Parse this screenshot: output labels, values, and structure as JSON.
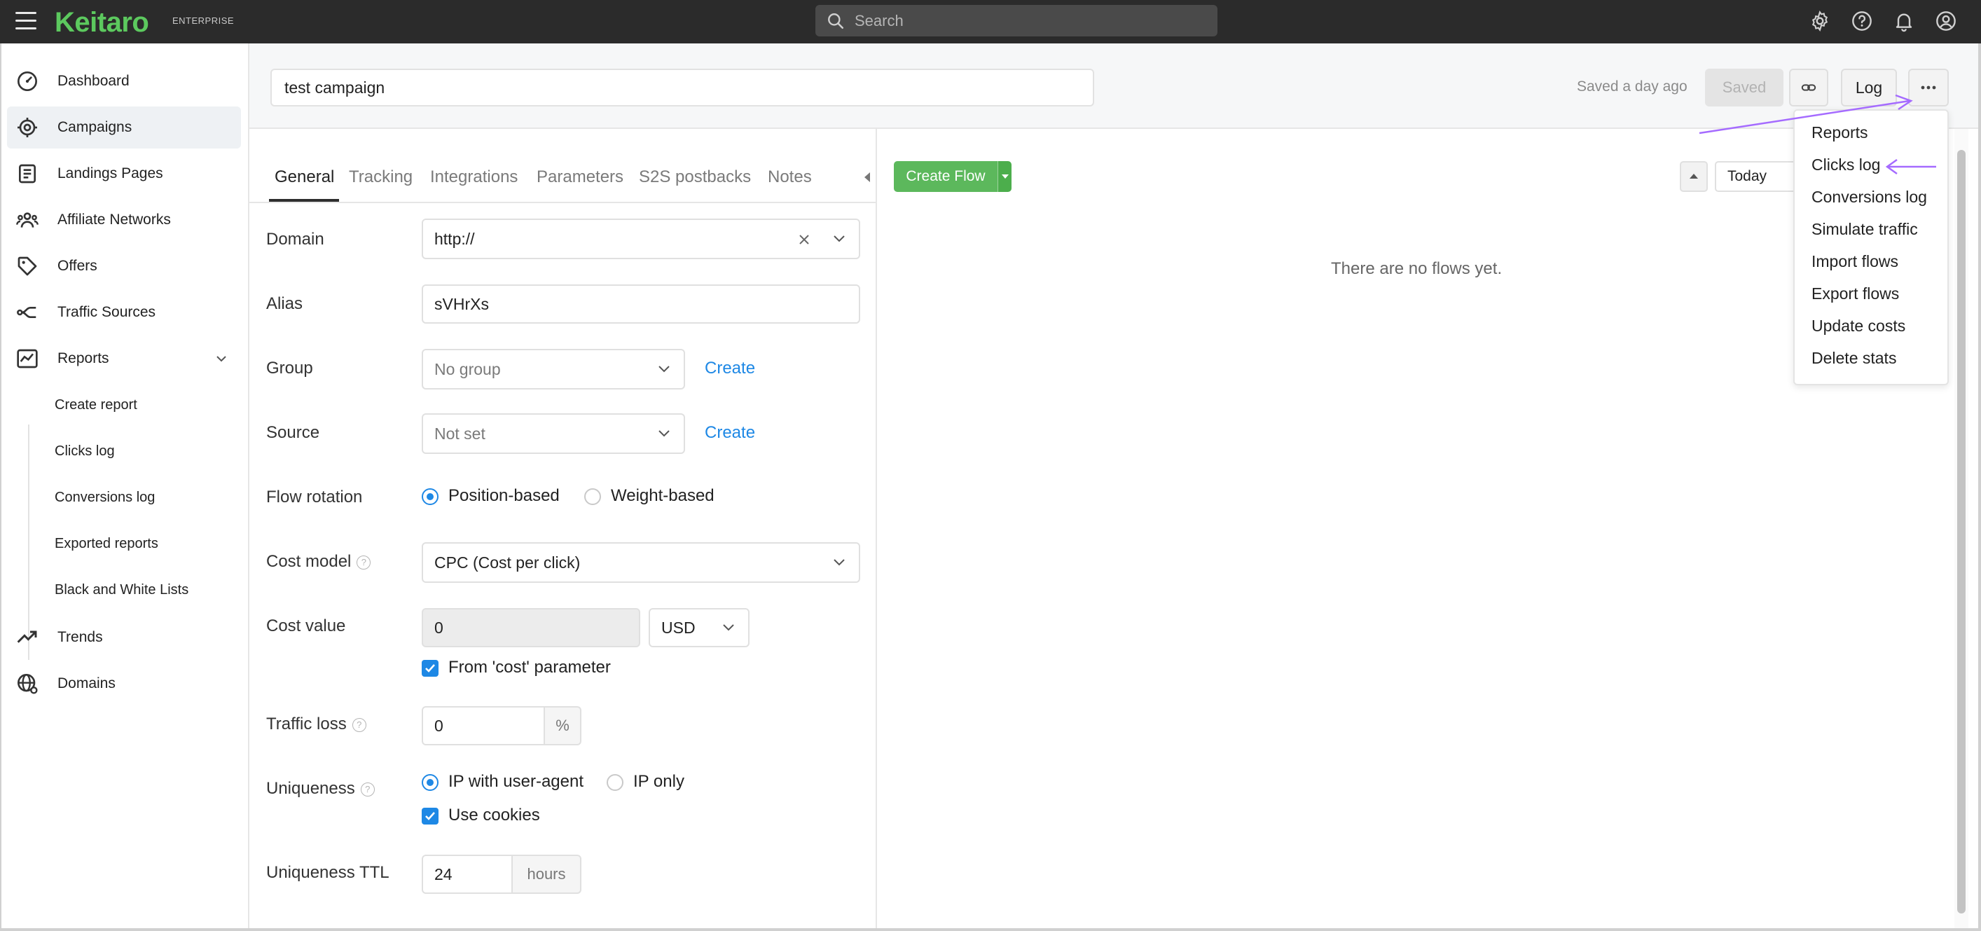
{
  "app": {
    "logo": "Keitaro",
    "edition": "ENTERPRISE",
    "search_placeholder": "Search"
  },
  "sidebar": {
    "items": [
      {
        "label": "Dashboard",
        "icon": "dashboard-icon"
      },
      {
        "label": "Campaigns",
        "icon": "target-icon",
        "active": true
      },
      {
        "label": "Landings Pages",
        "icon": "page-icon"
      },
      {
        "label": "Affiliate Networks",
        "icon": "users-icon"
      },
      {
        "label": "Offers",
        "icon": "tag-icon"
      },
      {
        "label": "Traffic Sources",
        "icon": "split-icon"
      },
      {
        "label": "Reports",
        "icon": "report-chart-icon",
        "expanded": true
      },
      {
        "label": "Trends",
        "icon": "trend-icon"
      },
      {
        "label": "Domains",
        "icon": "globe-icon"
      }
    ],
    "report_subitems": [
      "Create report",
      "Clicks log",
      "Conversions log",
      "Exported reports",
      "Black and White Lists"
    ]
  },
  "header": {
    "campaign_name": "test campaign",
    "saved_ago": "Saved a day ago",
    "saved_button": "Saved",
    "log_button": "Log"
  },
  "tabs": [
    "General",
    "Tracking",
    "Integrations",
    "Parameters",
    "S2S postbacks",
    "Notes"
  ],
  "form": {
    "domain_label": "Domain",
    "domain_value": "http://",
    "alias_label": "Alias",
    "alias_value": "sVHrXs",
    "group_label": "Group",
    "group_value": "No group",
    "create_link": "Create",
    "source_label": "Source",
    "source_value": "Not set",
    "flow_rotation_label": "Flow rotation",
    "flow_rotation_options": [
      "Position-based",
      "Weight-based"
    ],
    "flow_rotation_selected": "Position-based",
    "cost_model_label": "Cost model",
    "cost_model_value": "CPC (Cost per click)",
    "cost_value_label": "Cost value",
    "cost_value": "0",
    "currency": "USD",
    "from_cost_param": "From 'cost' parameter",
    "traffic_loss_label": "Traffic loss",
    "traffic_loss_value": "0",
    "percent_unit": "%",
    "uniqueness_label": "Uniqueness",
    "uniqueness_options": [
      "IP with user-agent",
      "IP only"
    ],
    "uniqueness_selected": "IP with user-agent",
    "use_cookies": "Use cookies",
    "uniqueness_ttl_label": "Uniqueness TTL",
    "uniqueness_ttl_value": "24",
    "hours_unit": "hours"
  },
  "flows": {
    "create_flow": "Create Flow",
    "empty_text": "There are no flows yet.",
    "date_range": "Today"
  },
  "menu": {
    "items": [
      "Reports",
      "Clicks log",
      "Conversions log",
      "Simulate traffic",
      "Import flows",
      "Export flows",
      "Update costs",
      "Delete stats"
    ]
  },
  "colors": {
    "accent_green": "#5cc95e",
    "link_blue": "#1e88e5",
    "annotation_purple": "#a56bff",
    "topbar": "#2b2b2b"
  }
}
